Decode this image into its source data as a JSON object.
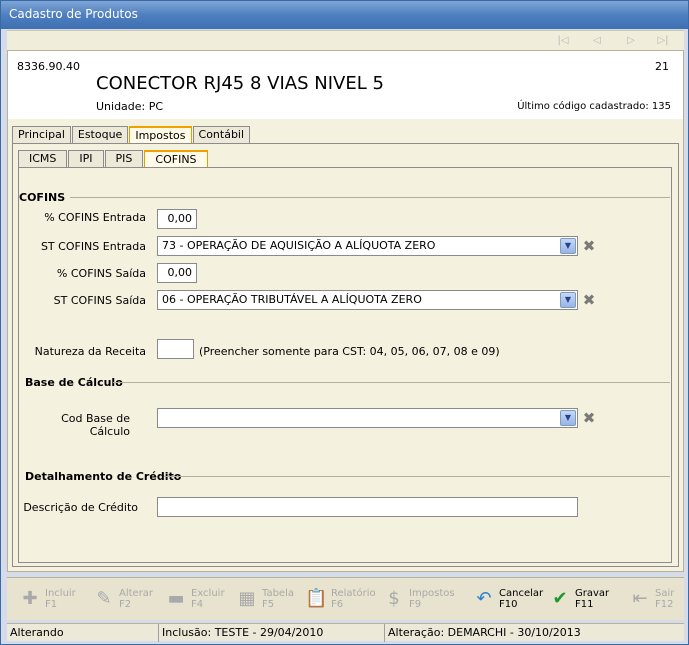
{
  "window": {
    "title": "Cadastro de Produtos"
  },
  "nav": {
    "first": "first-icon",
    "prev": "prev-icon",
    "next": "next-icon",
    "last": "last-icon"
  },
  "header": {
    "product_code": "8336.90.40",
    "product_name": "CONECTOR RJ45 8 VIAS NIVEL 5",
    "unit": "Unidade:  PC",
    "seq": "21",
    "last_code": "Último código cadastrado: 135"
  },
  "tabs": {
    "main": [
      "Principal",
      "Estoque",
      "Impostos",
      "Contábil"
    ],
    "sub": [
      "ICMS",
      "IPI",
      "PIS",
      "COFINS"
    ]
  },
  "cofins": {
    "section": "COFINS",
    "entrada_pct_label": "% COFINS Entrada",
    "entrada_pct_value": "0,00",
    "entrada_st_label": "ST COFINS Entrada",
    "entrada_st_value": "73 - OPERAÇÃO DE AQUISIÇÃO A ALÍQUOTA ZERO",
    "saida_pct_label": "% COFINS Saída",
    "saida_pct_value": "0,00",
    "saida_st_label": "ST COFINS Saída",
    "saida_st_value": "06 - OPERAÇÃO TRIBUTÁVEL A ALÍQUOTA ZERO",
    "natureza_label": "Natureza da Receita",
    "natureza_value": "",
    "natureza_hint": "(Preencher somente para CST: 04, 05, 06, 07, 08 e 09)"
  },
  "base": {
    "section": "Base de Cálculo",
    "cod_label": "Cod Base de Cálculo",
    "cod_value": ""
  },
  "credito": {
    "section": "Detalhamento de Crédito",
    "desc_label": "Descrição de Crédito",
    "desc_value": ""
  },
  "toolbar": {
    "incluir": "Incluir",
    "incluir_key": "F1",
    "alterar": "Alterar",
    "alterar_key": "F2",
    "excluir": "Excluir",
    "excluir_key": "F4",
    "tabela": "Tabela",
    "tabela_key": "F5",
    "relatorio": "Relatório",
    "relatorio_key": "F6",
    "impostos": "Impostos",
    "impostos_key": "F9",
    "cancelar": "Cancelar",
    "cancelar_key": "F10",
    "gravar": "Gravar",
    "gravar_key": "F11",
    "sair": "Sair",
    "sair_key": "F12"
  },
  "status": {
    "mode": "Alterando",
    "inclusao": "Inclusão: TESTE - 29/04/2010",
    "alteracao": "Alteração: DEMARCHI - 30/10/2013"
  }
}
